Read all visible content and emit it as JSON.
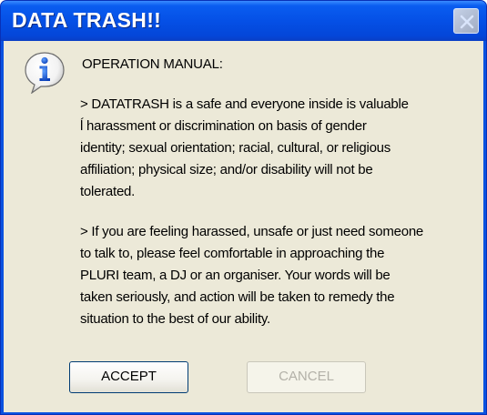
{
  "window": {
    "title": "DATA TRASH!!",
    "close_icon": "close-icon"
  },
  "dialog": {
    "icon": "info-icon",
    "heading": "OPERATION MANUAL:",
    "paragraph1": "> DATATRASH is a safe and everyone inside is valuable\nĺ harassment or discrimination on basis of gender\n identity; sexual orientation; racial, cultural, or religious\naffiliation; physical size; and/or disability will not be\ntolerated.",
    "paragraph2": "> If you are feeling harassed, unsafe or just need someone\n to talk to, please feel comfortable in approaching the\nPLURI team, a DJ or an organiser. Your words will be\n taken seriously, and action will be taken to remedy the\n situation to the best of our ability."
  },
  "buttons": {
    "accept_label": "ACCEPT",
    "cancel_label": "CANCEL"
  },
  "colors": {
    "titlebar": "#0550e6",
    "client": "#ece9d8",
    "disabled_text": "#b3b1a8"
  }
}
